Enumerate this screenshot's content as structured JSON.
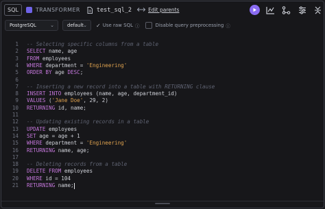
{
  "header": {
    "badge": "SQL",
    "node_type": "TRANSFORMER",
    "file_name": "test_sql_2",
    "edit_parents": "Edit parents"
  },
  "options": {
    "database": "PostgreSQL",
    "profile": "default",
    "use_raw_sql": "Use raw SQL",
    "disable_preprocessing": "Disable query preprocessing"
  },
  "editor": {
    "lines": [
      {
        "n": "1",
        "tokens": [
          {
            "t": "-- Selecting specific columns from a table",
            "c": "com"
          }
        ]
      },
      {
        "n": "2",
        "tokens": [
          {
            "t": "SELECT",
            "c": "kw"
          },
          {
            "t": " name, age",
            "c": "pl"
          }
        ]
      },
      {
        "n": "3",
        "tokens": [
          {
            "t": "FROM",
            "c": "kw"
          },
          {
            "t": " employees",
            "c": "pl"
          }
        ]
      },
      {
        "n": "4",
        "tokens": [
          {
            "t": "WHERE",
            "c": "kw"
          },
          {
            "t": " department = ",
            "c": "pl"
          },
          {
            "t": "'Engineering'",
            "c": "str"
          }
        ]
      },
      {
        "n": "5",
        "tokens": [
          {
            "t": "ORDER BY",
            "c": "kw"
          },
          {
            "t": " age ",
            "c": "pl"
          },
          {
            "t": "DESC",
            "c": "kw"
          },
          {
            "t": ";",
            "c": "pl"
          }
        ]
      },
      {
        "n": "6",
        "tokens": []
      },
      {
        "n": "7",
        "tokens": [
          {
            "t": "-- Inserting a new record into a table with RETURNING clause",
            "c": "com"
          }
        ]
      },
      {
        "n": "8",
        "tokens": [
          {
            "t": "INSERT INTO",
            "c": "kw"
          },
          {
            "t": " employees (name, age, department_id)",
            "c": "pl"
          }
        ]
      },
      {
        "n": "9",
        "tokens": [
          {
            "t": "VALUES",
            "c": "kw"
          },
          {
            "t": " (",
            "c": "pl"
          },
          {
            "t": "'Jane Doe'",
            "c": "str"
          },
          {
            "t": ", 29, 2)",
            "c": "pl"
          }
        ]
      },
      {
        "n": "10",
        "tokens": [
          {
            "t": "RETURNING",
            "c": "kw"
          },
          {
            "t": " id, name;",
            "c": "pl"
          }
        ]
      },
      {
        "n": "11",
        "tokens": []
      },
      {
        "n": "12",
        "tokens": [
          {
            "t": "-- Updating existing records in a table",
            "c": "com"
          }
        ]
      },
      {
        "n": "13",
        "tokens": [
          {
            "t": "UPDATE",
            "c": "kw"
          },
          {
            "t": " employees",
            "c": "pl"
          }
        ]
      },
      {
        "n": "14",
        "tokens": [
          {
            "t": "SET",
            "c": "kw"
          },
          {
            "t": " age = age + 1",
            "c": "pl"
          }
        ]
      },
      {
        "n": "15",
        "tokens": [
          {
            "t": "WHERE",
            "c": "kw"
          },
          {
            "t": " department = ",
            "c": "pl"
          },
          {
            "t": "'Engineering'",
            "c": "str"
          }
        ]
      },
      {
        "n": "16",
        "tokens": [
          {
            "t": "RETURNING",
            "c": "kw"
          },
          {
            "t": " name, age;",
            "c": "pl"
          }
        ]
      },
      {
        "n": "17",
        "tokens": []
      },
      {
        "n": "18",
        "tokens": [
          {
            "t": "-- Deleting records from a table",
            "c": "com"
          }
        ]
      },
      {
        "n": "19",
        "tokens": [
          {
            "t": "DELETE FROM",
            "c": "kw"
          },
          {
            "t": " employees",
            "c": "pl"
          }
        ]
      },
      {
        "n": "20",
        "tokens": [
          {
            "t": "WHERE",
            "c": "kw"
          },
          {
            "t": " id = 104",
            "c": "pl"
          }
        ]
      },
      {
        "n": "21",
        "tokens": [
          {
            "t": "RETURNING",
            "c": "kw"
          },
          {
            "t": " name;",
            "c": "pl"
          }
        ]
      }
    ]
  },
  "colors": {
    "accent": "#8a6cf2",
    "keyword": "#c678dd",
    "string": "#e0a34f",
    "comment": "#5f6372",
    "background": "#17171a"
  },
  "icons": {
    "node": "transformer-icon",
    "file": "file-icon",
    "edit": "arrows-icon",
    "run": "play-icon",
    "chart": "chart-icon",
    "tree": "tree-icon",
    "settings": "sliders-icon",
    "collapse": "collapse-icon"
  }
}
